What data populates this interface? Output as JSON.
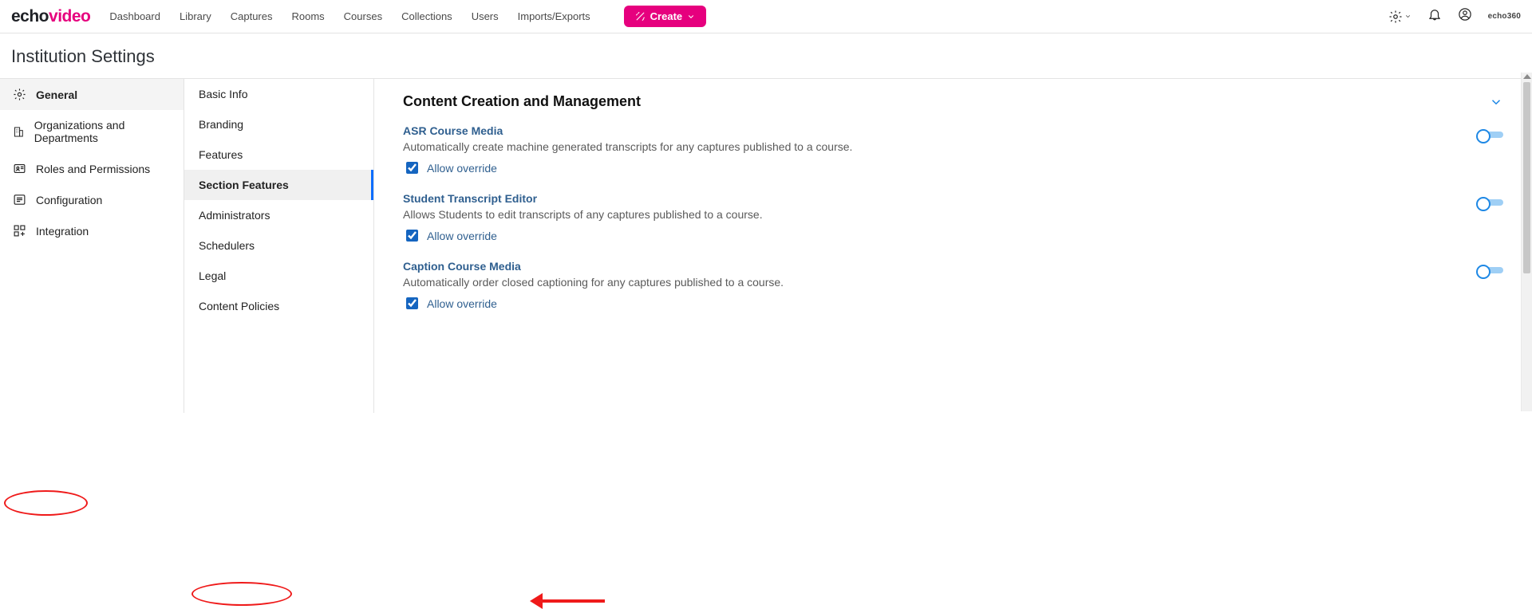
{
  "logo": {
    "text1": "echo",
    "text2": "video"
  },
  "topnav": {
    "items": [
      "Dashboard",
      "Library",
      "Captures",
      "Rooms",
      "Courses",
      "Collections",
      "Users",
      "Imports/Exports"
    ],
    "create": "Create"
  },
  "brand_mini": "echo360",
  "page_title": "Institution Settings",
  "sidebar": {
    "items": [
      {
        "label": "General",
        "active": true
      },
      {
        "label": "Organizations and Departments",
        "active": false
      },
      {
        "label": "Roles and Permissions",
        "active": false
      },
      {
        "label": "Configuration",
        "active": false
      },
      {
        "label": "Integration",
        "active": false
      }
    ]
  },
  "subnav": {
    "items": [
      {
        "label": "Basic Info",
        "active": false
      },
      {
        "label": "Branding",
        "active": false
      },
      {
        "label": "Features",
        "active": false
      },
      {
        "label": "Section Features",
        "active": true
      },
      {
        "label": "Administrators",
        "active": false
      },
      {
        "label": "Schedulers",
        "active": false
      },
      {
        "label": "Legal",
        "active": false
      },
      {
        "label": "Content Policies",
        "active": false
      }
    ]
  },
  "content": {
    "heading": "Content Creation and Management",
    "settings": [
      {
        "title": "ASR Course Media",
        "desc": "Automatically create machine generated transcripts for any captures published to a course.",
        "override": "Allow override",
        "override_checked": true,
        "toggle_on": false
      },
      {
        "title": "Student Transcript Editor",
        "desc": "Allows Students to edit transcripts of any captures published to a course.",
        "override": "Allow override",
        "override_checked": true,
        "toggle_on": false
      },
      {
        "title": "Caption Course Media",
        "desc": "Automatically order closed captioning for any captures published to a course.",
        "override": "Allow override",
        "override_checked": true,
        "toggle_on": false
      }
    ]
  },
  "annotations": {
    "ellipse_general": true,
    "ellipse_section_features": true,
    "arrow_student_transcript": true
  }
}
